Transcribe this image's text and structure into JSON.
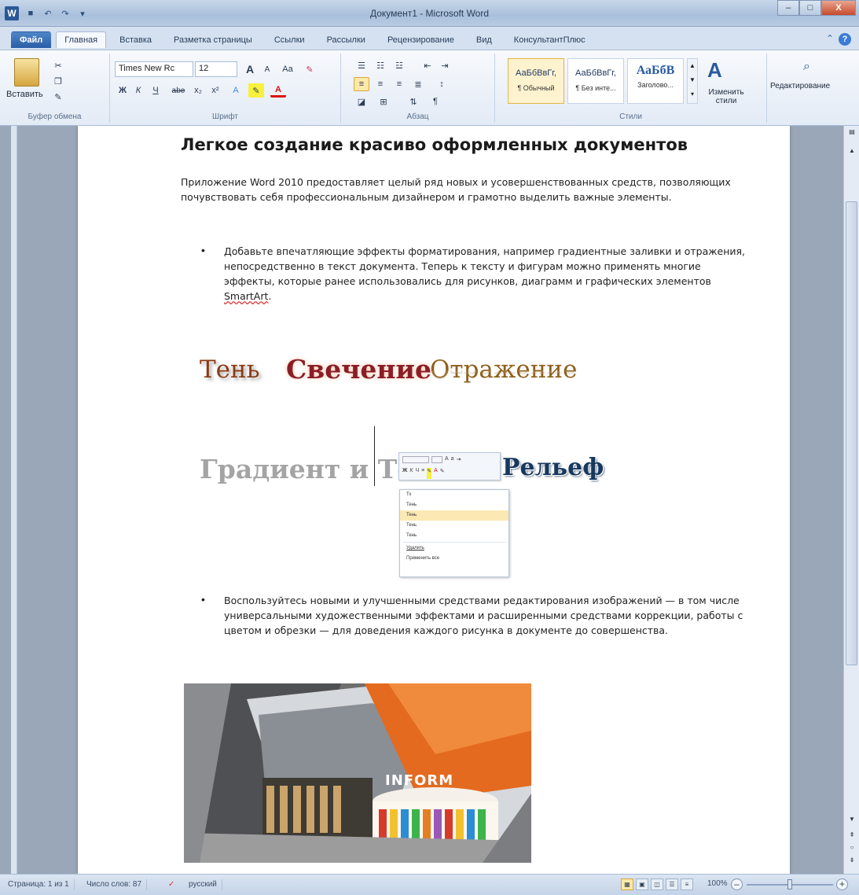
{
  "window": {
    "title": "Документ1 - Microsoft Word",
    "app_icon": "W",
    "minimize": "–",
    "maximize": "□",
    "close": "X"
  },
  "quick_access": [
    "save-icon",
    "undo-icon",
    "redo-icon",
    "customize-icon"
  ],
  "tabs": {
    "file": "Файл",
    "items": [
      "Главная",
      "Вставка",
      "Разметка страницы",
      "Ссылки",
      "Рассылки",
      "Рецензирование",
      "Вид",
      "КонсультантПлюс"
    ],
    "active_index": 0
  },
  "ribbon": {
    "clipboard": {
      "paste_label": "Вставить",
      "group_label": "Буфер обмена"
    },
    "font": {
      "font_name": "Times New Rc",
      "font_size": "12",
      "grow": "A",
      "shrink": "A",
      "case": "Aa",
      "bold": "Ж",
      "italic": "К",
      "underline": "Ч",
      "strike": "abe",
      "subscript": "x₂",
      "superscript": "x²",
      "group_label": "Шрифт"
    },
    "paragraph": {
      "group_label": "Абзац",
      "pilcrow": "¶"
    },
    "styles": {
      "items": [
        {
          "sample": "АаБбВвГг,",
          "name": "¶ Обычный",
          "selected": true
        },
        {
          "sample": "АаБбВвГг,",
          "name": "¶ Без инте...",
          "selected": false
        },
        {
          "sample": "АаБбВ",
          "name": "Заголово...",
          "selected": false
        }
      ],
      "change_styles": "Изменить стили",
      "group_label": "Стили"
    },
    "editing": {
      "label": "Редактирование"
    }
  },
  "document": {
    "heading": "Легкое создание красиво оформленных документов",
    "intro": "Приложение Word 2010 предоставляет целый ряд новых и усовершенствованных средств, позволяющих почувствовать себя профессиональным дизайнером и грамотно выделить важные элементы.",
    "bullet1": "Добавьте впечатляющие эффекты форматирования, например градиентные заливки и отражения, непосредственно в текст документа. Теперь к тексту и фигурам можно применять многие эффекты, которые ранее использовались для рисунков, диаграмм и графических элементов ",
    "bullet1_link": "SmartArt",
    "bullet1_end": ".",
    "effects": {
      "shadow": "Тень",
      "glow": "Свечение",
      "reflection": "Отражение",
      "gradient": "Градиент и Тень",
      "relief": "Рельеф"
    },
    "context_menu": [
      "Тх",
      "Тень",
      "Тень",
      "Тень",
      "Тень",
      "Удалить",
      "Применить все"
    ],
    "bullet2": "Воспользуйтесь новыми и улучшенными средствами редактирования изображений — в том числе универсальными художественными эффектами и расширенными средствами коррекции, работы с цветом и обрезки — для доведения каждого рисунка в документе до совершенства.",
    "photo_sign": "INFORM"
  },
  "status": {
    "page": "Страница: 1 из 1",
    "words": "Число слов: 87",
    "language": "русский",
    "zoom": "100%",
    "zoom_percent": 100
  }
}
